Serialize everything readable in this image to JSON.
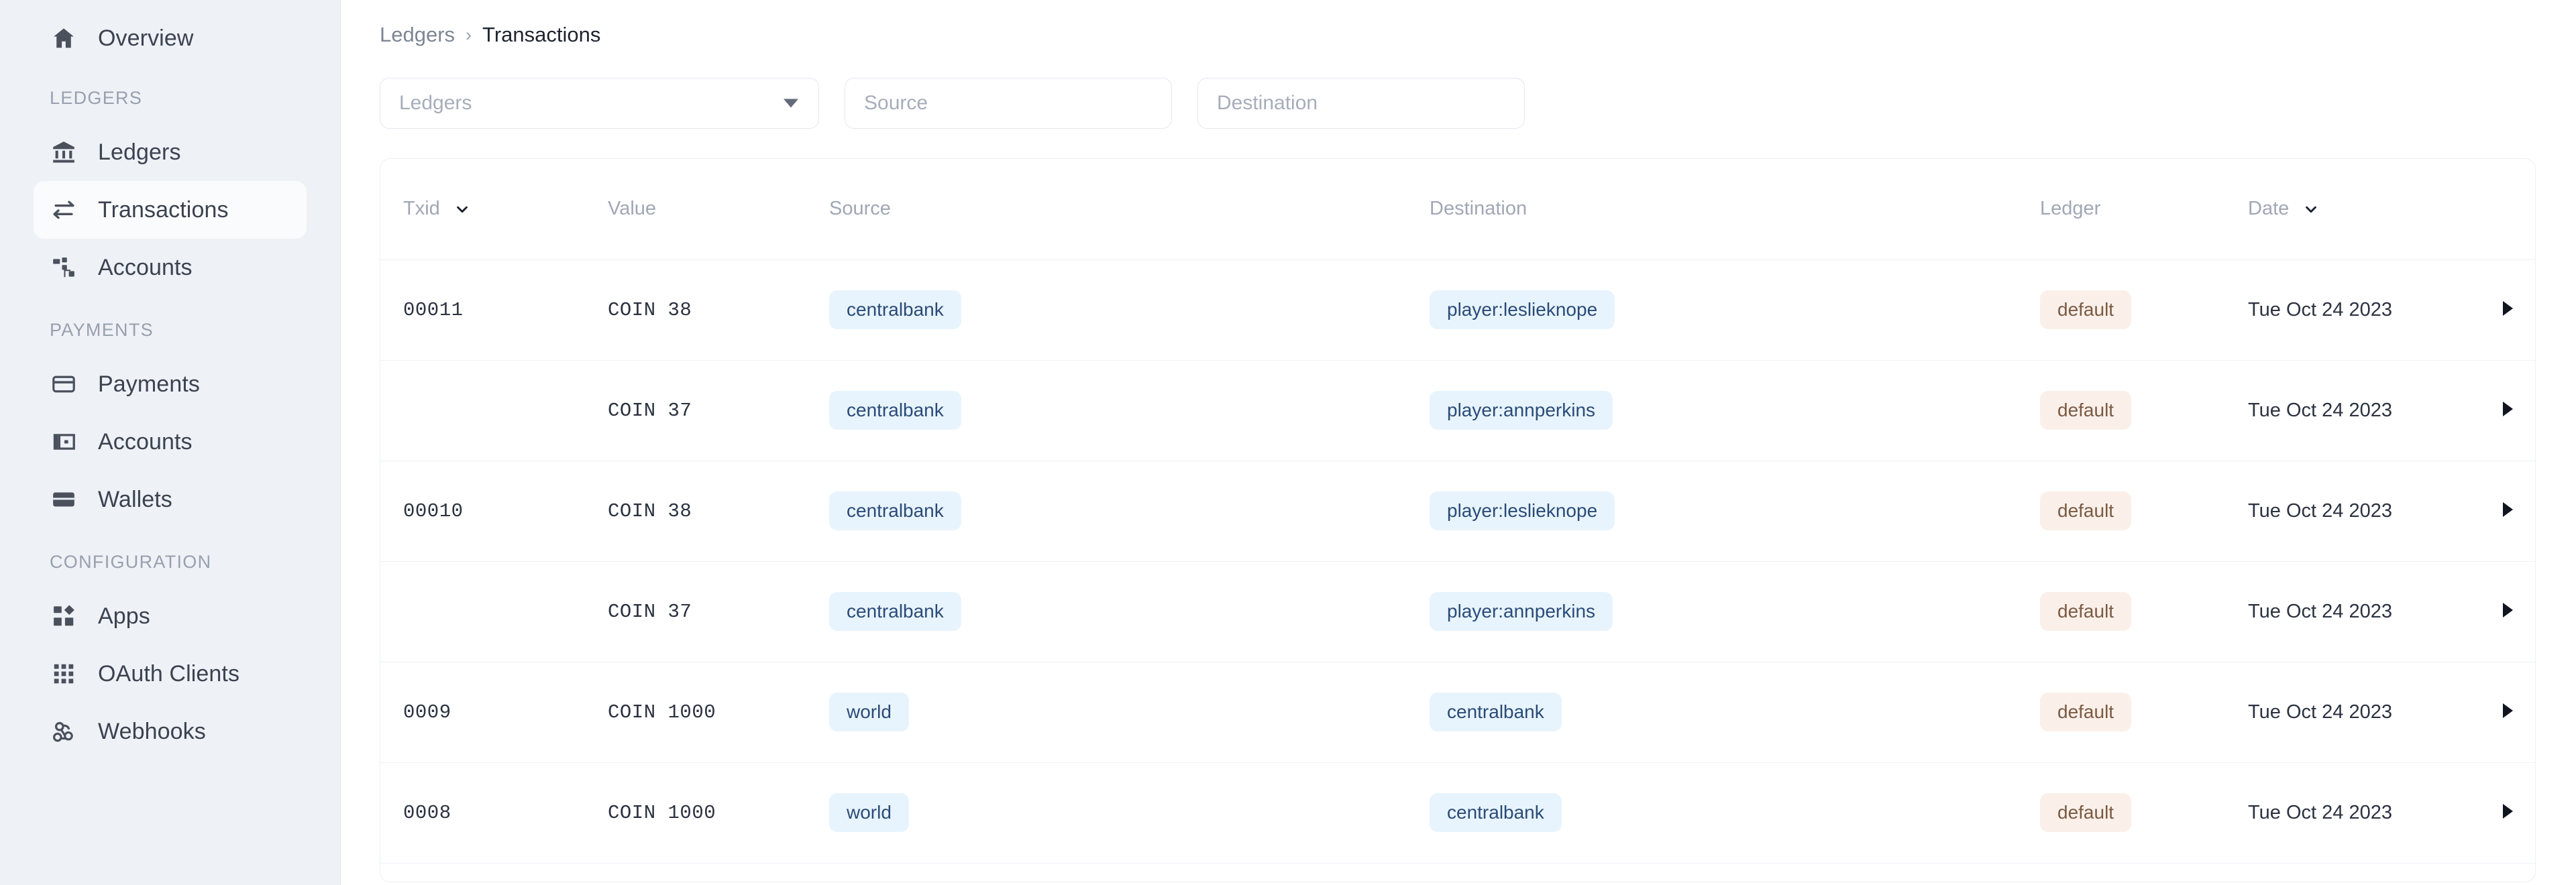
{
  "sidebar": {
    "top_items": [
      {
        "label": "Overview",
        "icon": "home-icon",
        "active": false
      }
    ],
    "sections": [
      {
        "title": "LEDGERS",
        "items": [
          {
            "label": "Ledgers",
            "icon": "bank-icon",
            "active": false
          },
          {
            "label": "Transactions",
            "icon": "transfer-icon",
            "active": true
          },
          {
            "label": "Accounts",
            "icon": "org-chart-icon",
            "active": false
          }
        ]
      },
      {
        "title": "PAYMENTS",
        "items": [
          {
            "label": "Payments",
            "icon": "credit-card-icon",
            "active": false
          },
          {
            "label": "Accounts",
            "icon": "wallet-card-icon",
            "active": false
          },
          {
            "label": "Wallets",
            "icon": "wallet-icon",
            "active": false
          }
        ]
      },
      {
        "title": "CONFIGURATION",
        "items": [
          {
            "label": "Apps",
            "icon": "apps-icon",
            "active": false
          },
          {
            "label": "OAuth Clients",
            "icon": "grid-dots-icon",
            "active": false
          },
          {
            "label": "Webhooks",
            "icon": "webhook-icon",
            "active": false
          }
        ]
      }
    ]
  },
  "breadcrumb": {
    "parent": "Ledgers",
    "separator": "›",
    "current": "Transactions"
  },
  "filters": {
    "ledgers_placeholder": "Ledgers",
    "source_placeholder": "Source",
    "destination_placeholder": "Destination",
    "ledgers_value": "",
    "source_value": "",
    "destination_value": ""
  },
  "table": {
    "columns": [
      {
        "key": "txid",
        "label": "Txid",
        "sortable": true
      },
      {
        "key": "value",
        "label": "Value",
        "sortable": false
      },
      {
        "key": "source",
        "label": "Source",
        "sortable": false
      },
      {
        "key": "destination",
        "label": "Destination",
        "sortable": false
      },
      {
        "key": "ledger",
        "label": "Ledger",
        "sortable": false
      },
      {
        "key": "date",
        "label": "Date",
        "sortable": true
      }
    ],
    "rows": [
      {
        "txid": "00011",
        "value": "COIN 38",
        "source": "centralbank",
        "destination": "player:leslieknope",
        "ledger": "default",
        "date": "Tue Oct 24 2023"
      },
      {
        "txid": "",
        "value": "COIN 37",
        "source": "centralbank",
        "destination": "player:annperkins",
        "ledger": "default",
        "date": "Tue Oct 24 2023"
      },
      {
        "txid": "00010",
        "value": "COIN 38",
        "source": "centralbank",
        "destination": "player:leslieknope",
        "ledger": "default",
        "date": "Tue Oct 24 2023"
      },
      {
        "txid": "",
        "value": "COIN 37",
        "source": "centralbank",
        "destination": "player:annperkins",
        "ledger": "default",
        "date": "Tue Oct 24 2023"
      },
      {
        "txid": "0009",
        "value": "COIN 1000",
        "source": "world",
        "destination": "centralbank",
        "ledger": "default",
        "date": "Tue Oct 24 2023"
      },
      {
        "txid": "0008",
        "value": "COIN 1000",
        "source": "world",
        "destination": "centralbank",
        "ledger": "default",
        "date": "Tue Oct 24 2023"
      }
    ]
  },
  "colors": {
    "sidebar_bg": "#eef1f6",
    "active_nav_bg": "#fafbfc",
    "chip_blue_bg": "#e8f4fd",
    "chip_blue_fg": "#2a4b78",
    "chip_peach_bg": "#fbf0e9",
    "chip_peach_fg": "#7a5a43",
    "text_primary": "#2b3240",
    "text_muted": "#a0a7b5"
  }
}
